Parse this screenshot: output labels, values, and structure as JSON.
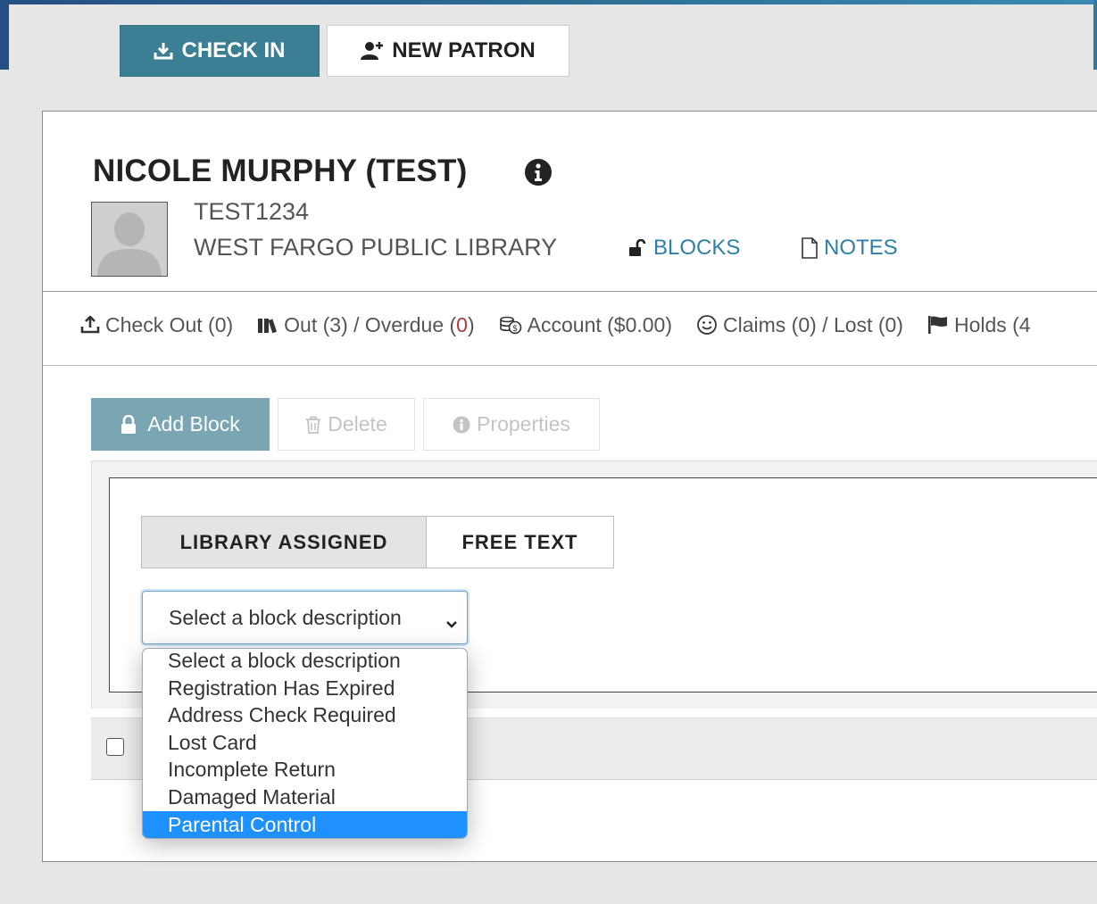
{
  "toolbar": {
    "check_in_label": "CHECK IN",
    "new_patron_label": "NEW PATRON"
  },
  "patron": {
    "name": "NICOLE MURPHY (TEST)",
    "id": "TEST1234",
    "library": "WEST FARGO PUBLIC LIBRARY",
    "blocks_link": "BLOCKS",
    "notes_link": "NOTES"
  },
  "nav": {
    "check_out": "Check Out (0)",
    "out_prefix": "Out (3) / Overdue (",
    "overdue_count": "0",
    "out_suffix": ")",
    "account": "Account ($0.00)",
    "claims": "Claims (0) / Lost (0)",
    "holds": "Holds (4"
  },
  "actions": {
    "add_block": "Add Block",
    "delete": "Delete",
    "properties": "Properties"
  },
  "tabs": {
    "library_assigned": "LIBRARY ASSIGNED",
    "free_text": "FREE TEXT"
  },
  "select": {
    "current_value": "Select a block description",
    "options": [
      "Select a block description",
      "Registration Has Expired",
      "Address Check Required",
      "Lost Card",
      "Incomplete Return",
      "Damaged Material",
      "Parental Control"
    ],
    "highlighted_option": "Parental Control"
  },
  "colors": {
    "check_in_bg": "#3c7f94",
    "link": "#2f7fa6",
    "add_block_bg": "#7aa6b3",
    "overdue_red": "#b23a3a",
    "option_highlight": "#1e90ff",
    "header_band": "#2c6f97"
  },
  "icons": {
    "check_in": "download-tray-icon",
    "new_patron": "user-plus-icon",
    "info": "info-circle-icon",
    "blocks": "unlock-icon",
    "notes": "file-icon",
    "check_out": "upload-tray-icon",
    "out": "books-icon",
    "account": "coins-icon",
    "claims": "smile-icon",
    "holds": "flag-icon",
    "add_block": "lock-icon",
    "delete": "trash-icon",
    "properties": "info-circle-icon",
    "select_chevron": "chevron-down-icon"
  }
}
